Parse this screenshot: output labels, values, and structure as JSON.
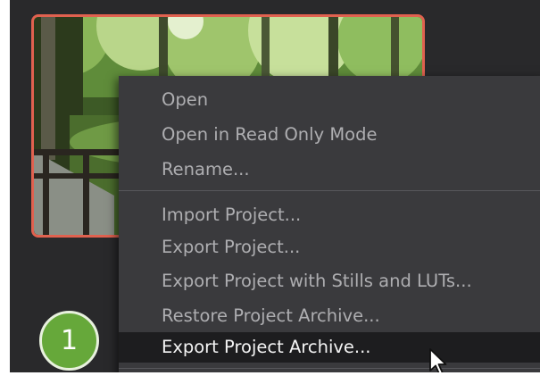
{
  "context_menu": {
    "items": [
      {
        "label": "Open"
      },
      {
        "label": "Open in Read Only Mode"
      },
      {
        "label": "Rename..."
      },
      {
        "label": "Import Project..."
      },
      {
        "label": "Export Project..."
      },
      {
        "label": "Export Project with Stills and LUTs..."
      },
      {
        "label": "Restore Project Archive..."
      },
      {
        "label": "Export Project Archive...",
        "highlighted": true
      }
    ]
  },
  "step_badge": {
    "number": "1"
  },
  "colors": {
    "thumbnail_selected_border": "#e0614f",
    "step_badge": "#66a83a",
    "menu_background": "#3a3a3d",
    "menu_highlight": "#1d1d1f"
  }
}
